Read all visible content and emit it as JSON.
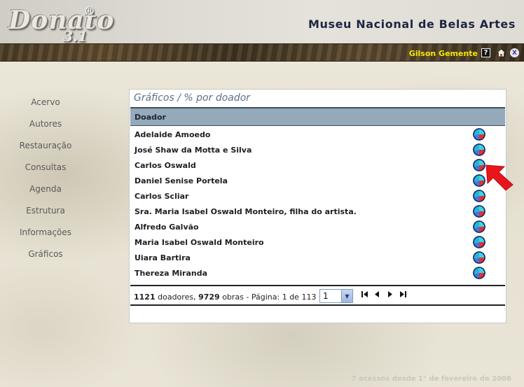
{
  "app": {
    "logo_word": "Donato",
    "logo_reg": "®",
    "logo_version": "3.1",
    "museum_title": "Museu Nacional de Belas Artes"
  },
  "topbar": {
    "user_name": "Gilson Gemente",
    "help_icon": "?",
    "home_icon": "home-icon",
    "exit_icon": "X"
  },
  "sidebar": {
    "items": [
      {
        "label": "Acervo"
      },
      {
        "label": "Autores"
      },
      {
        "label": "Restauração"
      },
      {
        "label": "Consultas"
      },
      {
        "label": "Agenda"
      },
      {
        "label": "Estrutura"
      },
      {
        "label": "Informações"
      },
      {
        "label": "Gráficos"
      }
    ]
  },
  "panel": {
    "title": "Gráficos / % por doador",
    "column_header": "Doador",
    "rows": [
      {
        "name": "Adelaide Amoedo"
      },
      {
        "name": "José Shaw da Motta e Silva"
      },
      {
        "name": "Carlos Oswald"
      },
      {
        "name": "Daniel Senise Portela"
      },
      {
        "name": "Carlos Scliar"
      },
      {
        "name": "Sra. Maria Isabel Oswald Monteiro, filha do artista."
      },
      {
        "name": "Alfredo Galvão"
      },
      {
        "name": "Maria Isabel Oswald Monteiro"
      },
      {
        "name": "Uiara Bartira"
      },
      {
        "name": "Thereza Miranda"
      }
    ],
    "footer": {
      "donors_count": "1121",
      "donors_label": "doadores,",
      "works_count": "9729",
      "works_label": "obras - Página: 1 de 113",
      "page_select_value": "1",
      "pager_first": "first-page-icon",
      "pager_prev": "prev-page-icon",
      "pager_next": "next-page-icon",
      "pager_last": "last-page-icon"
    }
  },
  "access_count": "7 acessos desde 1° de fevereiro de 2008",
  "colors": {
    "header_bar": "#94a9ba",
    "user_name": "#f6e800",
    "title_color": "#1d2743",
    "arrow": "#e8161c"
  }
}
